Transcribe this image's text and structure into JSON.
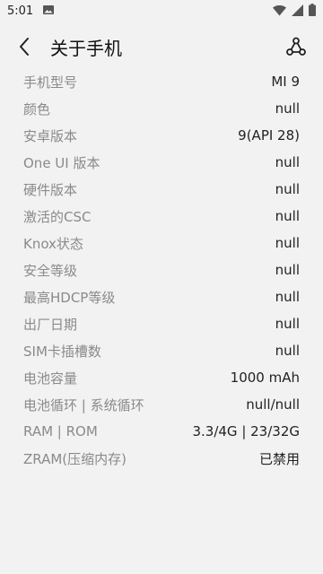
{
  "status_bar": {
    "time": "5:01",
    "icons": [
      "image-icon",
      "wifi-icon",
      "signal-icon",
      "battery-icon"
    ]
  },
  "app_bar": {
    "title": "关于手机",
    "back_icon": "chevron-left-icon",
    "action_icon": "share-nodes-icon"
  },
  "colors": {
    "background": "#f2f2f2",
    "label": "#8a8a8a",
    "value": "#222222"
  },
  "info": [
    {
      "label": "手机型号",
      "value": "MI 9"
    },
    {
      "label": "颜色",
      "value": "null"
    },
    {
      "label": "安卓版本",
      "value": "9(API 28)"
    },
    {
      "label": "One UI 版本",
      "value": "null"
    },
    {
      "label": "硬件版本",
      "value": "null"
    },
    {
      "label": "激活的CSC",
      "value": "null"
    },
    {
      "label": "Knox状态",
      "value": "null"
    },
    {
      "label": "安全等级",
      "value": "null"
    },
    {
      "label": "最高HDCP等级",
      "value": "null"
    },
    {
      "label": "出厂日期",
      "value": "null"
    },
    {
      "label": "SIM卡插槽数",
      "value": "null"
    },
    {
      "label": "电池容量",
      "value": "1000 mAh"
    },
    {
      "label": "电池循环 | 系统循环",
      "value": "null/null"
    },
    {
      "label": "RAM | ROM",
      "value": "3.3/4G | 23/32G"
    },
    {
      "label": "ZRAM(压缩内存)",
      "value": "已禁用"
    }
  ]
}
